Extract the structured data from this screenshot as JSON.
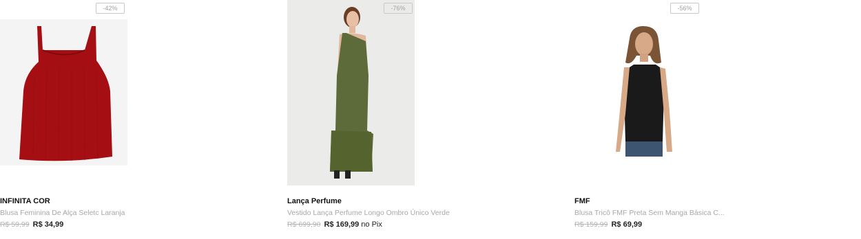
{
  "products": [
    {
      "discount": "-42%",
      "brand": "INFINITA COR",
      "name": "Blusa Feminina De Alça Seletc Laranja",
      "old_price": "R$ 59,99",
      "price": "R$ 34,99",
      "price_suffix": ""
    },
    {
      "discount": "-76%",
      "brand": "Lança Perfume",
      "name": "Vestido Lança Perfume Longo Ombro Único Verde",
      "old_price": "R$ 699,90",
      "price": "R$ 169,99",
      "price_suffix": "no Pix"
    },
    {
      "discount": "-56%",
      "brand": "FMF",
      "name": "Blusa Tricô FMF Preta Sem Manga Básica C...",
      "old_price": "R$ 159,99",
      "price": "R$ 69,99",
      "price_suffix": ""
    }
  ],
  "colors": {
    "red_top": "#a50f14",
    "green_dress": "#5d6b3a",
    "black_top": "#1a1a1a"
  }
}
